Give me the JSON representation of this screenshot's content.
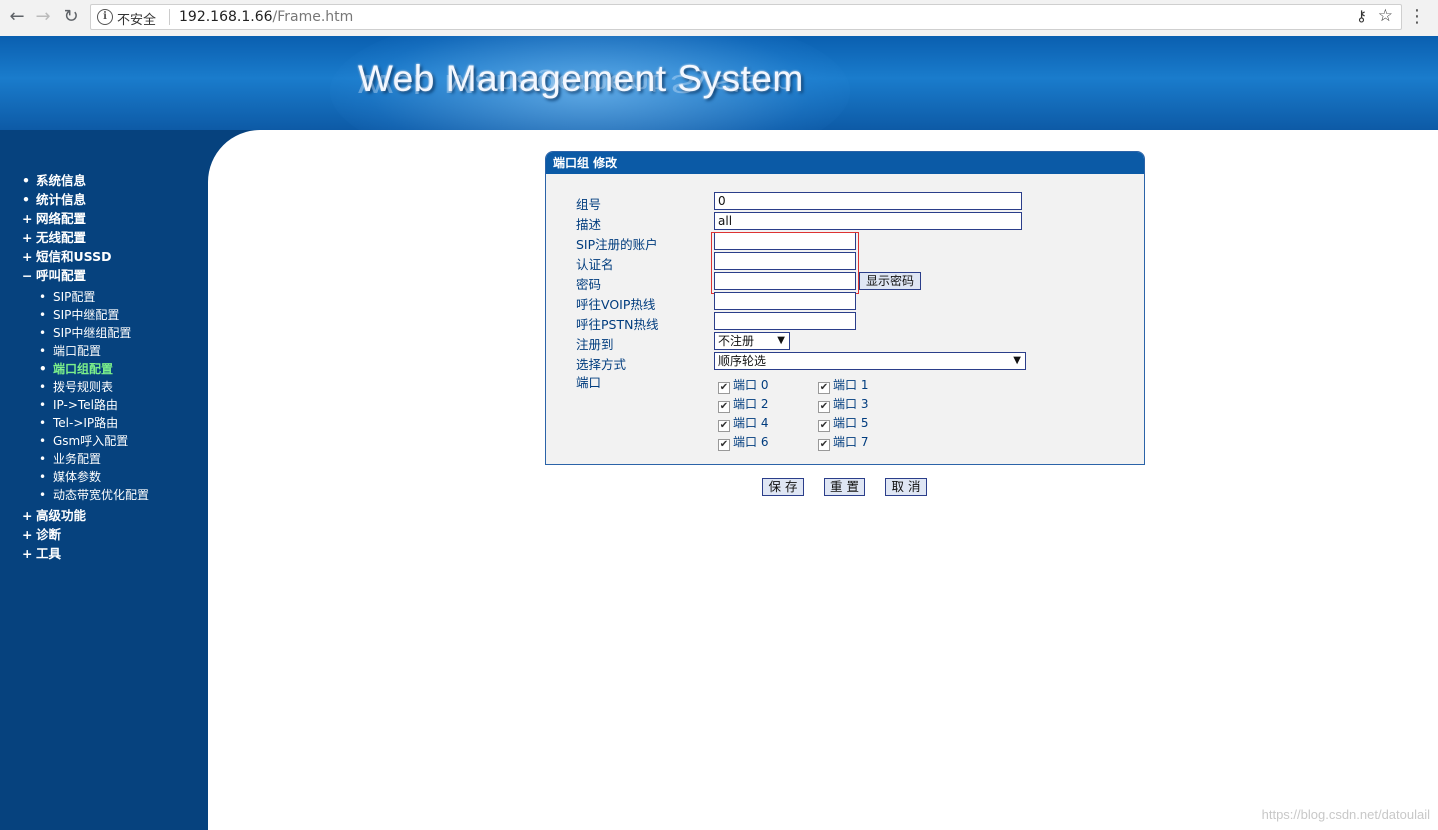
{
  "browser": {
    "security_label": "不安全",
    "url_host": "192.168.1.66",
    "url_path": "/Frame.htm"
  },
  "banner": {
    "title": "Web Management System"
  },
  "sidebar": {
    "items": [
      {
        "marker": "•",
        "label": "系统信息"
      },
      {
        "marker": "•",
        "label": "统计信息"
      },
      {
        "marker": "+",
        "label": "网络配置"
      },
      {
        "marker": "+",
        "label": "无线配置"
      },
      {
        "marker": "+",
        "label": "短信和USSD"
      },
      {
        "marker": "−",
        "label": "呼叫配置"
      },
      {
        "marker": "+",
        "label": "高级功能"
      },
      {
        "marker": "+",
        "label": "诊断"
      },
      {
        "marker": "+",
        "label": "工具"
      }
    ],
    "sub_items": [
      {
        "label": "SIP配置"
      },
      {
        "label": "SIP中继配置"
      },
      {
        "label": "SIP中继组配置"
      },
      {
        "label": "端口配置"
      },
      {
        "label": "端口组配置",
        "active": true
      },
      {
        "label": "拨号规则表"
      },
      {
        "label": "IP->Tel路由"
      },
      {
        "label": "Tel->IP路由"
      },
      {
        "label": "Gsm呼入配置"
      },
      {
        "label": "业务配置"
      },
      {
        "label": "媒体参数"
      },
      {
        "label": "动态带宽优化配置"
      }
    ],
    "sub_marker": "•"
  },
  "form": {
    "title": "端口组 修改",
    "fields": {
      "group_no": {
        "label": "组号",
        "value": "0"
      },
      "description": {
        "label": "描述",
        "value": "all"
      },
      "sip_account": {
        "label": "SIP注册的账户",
        "value": ""
      },
      "auth_name": {
        "label": "认证名",
        "value": ""
      },
      "password": {
        "label": "密码",
        "value": "",
        "button": "显示密码"
      },
      "voip_hotline": {
        "label": "呼往VOIP热线",
        "value": ""
      },
      "pstn_hotline": {
        "label": "呼往PSTN热线",
        "value": ""
      },
      "register_to": {
        "label": "注册到",
        "selected": "不注册"
      },
      "select_mode": {
        "label": "选择方式",
        "selected": "顺序轮选"
      },
      "ports_label": "端口"
    },
    "ports": [
      {
        "label": "端口 0",
        "checked": true
      },
      {
        "label": "端口 1",
        "checked": true
      },
      {
        "label": "端口 2",
        "checked": true
      },
      {
        "label": "端口 3",
        "checked": true
      },
      {
        "label": "端口 4",
        "checked": true
      },
      {
        "label": "端口 5",
        "checked": true
      },
      {
        "label": "端口 6",
        "checked": true
      },
      {
        "label": "端口 7",
        "checked": true
      }
    ],
    "check_glyph": "✔"
  },
  "actions": {
    "save": "保 存",
    "reset": "重 置",
    "cancel": "取 消"
  },
  "watermark": "https://blog.csdn.net/datoulail",
  "colors": {
    "sidebar_bg": "#06427e",
    "header_bg": "#0b5aa6",
    "active_menu": "#7cf08a",
    "label_text": "#003c7e"
  }
}
